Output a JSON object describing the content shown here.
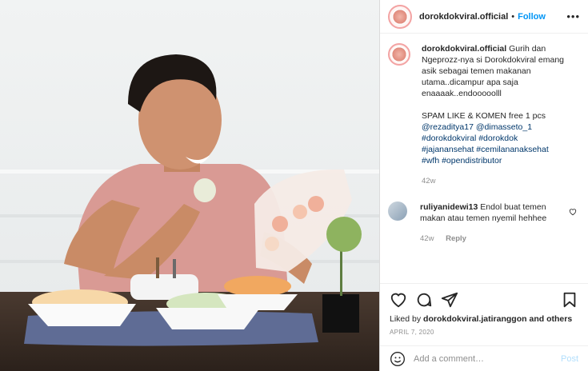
{
  "header": {
    "username": "dorokdokviral.official",
    "separator": "•",
    "follow_label": "Follow",
    "more_label": "•••"
  },
  "caption": {
    "username": "dorokdokviral.official",
    "text": "Gurih dan Ngeprozz-nya si Dorokdokviral emang asik sebagai temen makanan utama..dicampur apa saja enaaaak..endooooolll",
    "spam_text": "SPAM LIKE & KOMEN free 1 pcs",
    "tags": [
      "@rezaditya17 @dimasseto_1",
      "#dorokdokviral #dorokdok",
      "#jajanansehat #cemilananaksehat",
      "#wfh #opendistributor"
    ],
    "time": "42w"
  },
  "comment": {
    "username": "ruliyanidewi13",
    "text": "Endol buat temen makan atau temen nyemil hehhee",
    "time": "42w",
    "reply_label": "Reply"
  },
  "likes": {
    "prefix": "Liked by",
    "user": "dorokdokviral.jatiranggon",
    "suffix": "and others"
  },
  "date": "APRIL 7, 2020",
  "add_comment": {
    "placeholder": "Add a comment…",
    "post_label": "Post"
  },
  "icons": {
    "like": "heart-icon",
    "comment": "comment-icon",
    "share": "share-icon",
    "save": "bookmark-icon",
    "emoji": "emoji-icon"
  },
  "colors": {
    "link": "#0095f6",
    "tag": "#00376b",
    "muted": "#8e8e8e",
    "post_disabled": "#b2dffc"
  }
}
